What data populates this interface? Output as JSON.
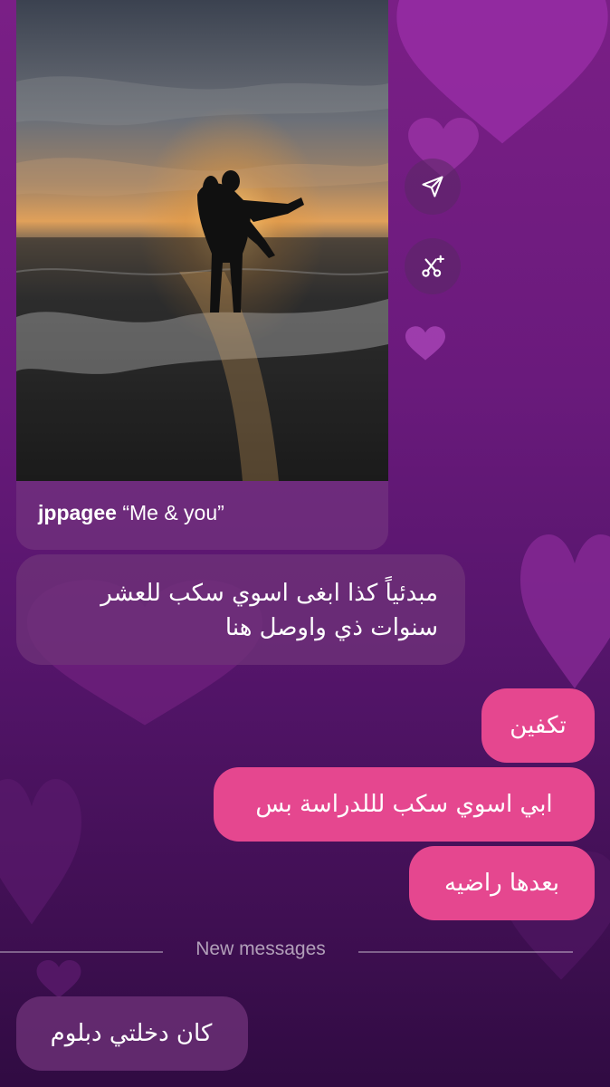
{
  "post": {
    "username": "jppagee",
    "caption": "“Me & you”"
  },
  "actions": {
    "share_icon": "paper-plane-icon",
    "remix_icon": "sparkle-scissors-icon"
  },
  "messages": [
    {
      "direction": "received",
      "text": "مبدئياً كذا ابغى اسوي سكب للعشر سنوات ذي واوصل هنا"
    },
    {
      "direction": "sent",
      "text": "تكفين"
    },
    {
      "direction": "sent",
      "text": "ابي اسوي سكب لللدراسة بس"
    },
    {
      "direction": "sent",
      "text": "بعدها راضيه"
    }
  ],
  "divider": {
    "label": "New messages"
  },
  "new_messages": [
    {
      "direction": "received",
      "text": "كان دخلتي دبلوم"
    }
  ],
  "colors": {
    "sent_bubble": "#e5478f",
    "received_bubble": "#6e3278",
    "background_top": "#7a1f86",
    "background_bottom": "#300b42"
  }
}
